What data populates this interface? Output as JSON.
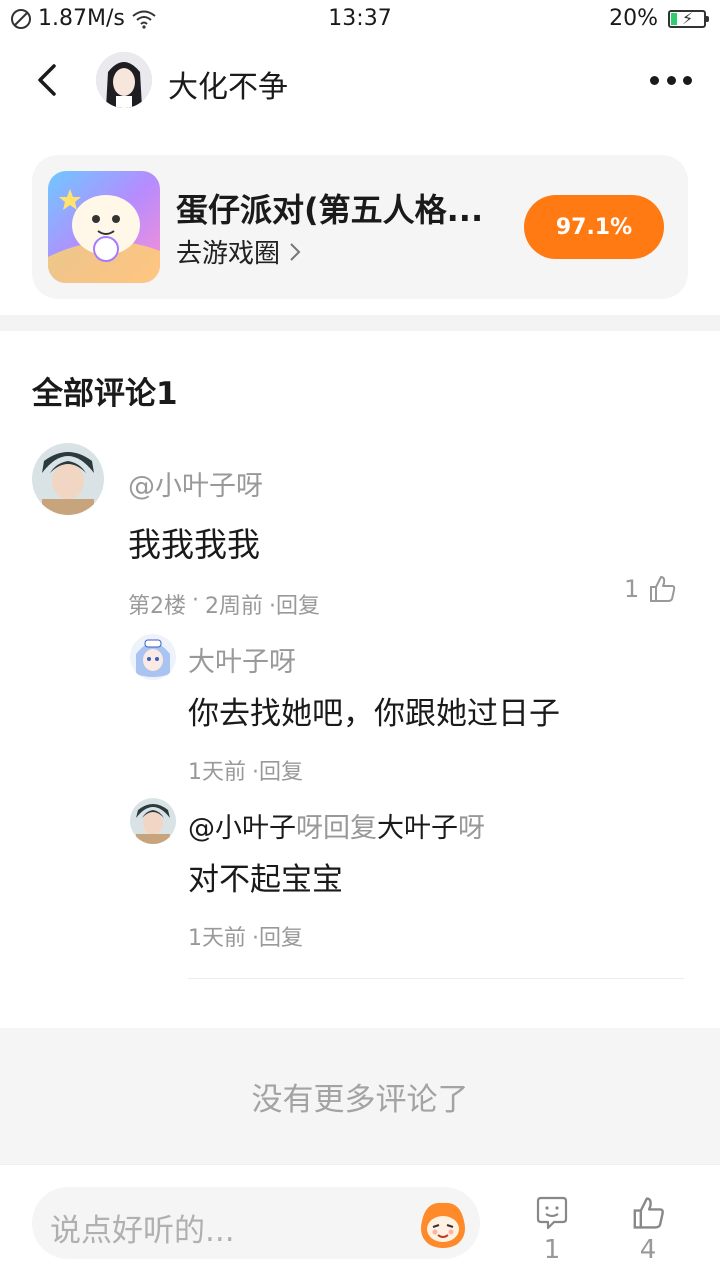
{
  "status_bar": {
    "speed": "1.87M/s",
    "time": "13:37",
    "battery": "20%",
    "battery_level": 0.2
  },
  "header": {
    "author_name": "大化不争"
  },
  "game_card": {
    "title": "蛋仔派对(第五人格...",
    "link_label": "去游戏圈",
    "rating": "97.1%"
  },
  "comments_section": {
    "title": "全部评论1",
    "comment": {
      "user": "@小叶子呀",
      "text": "我我我我",
      "floor": "第2楼",
      "time": "2周前",
      "reply_label": "·回复",
      "like_count": "1"
    },
    "replies": [
      {
        "user": "大叶子呀",
        "text": "你去找她吧，你跟她过日子",
        "time": "1天前",
        "reply_label": "·回复"
      },
      {
        "user_prefix": "@小叶子",
        "user_suffix": "呀",
        "reply_word": "回复",
        "target": "大叶子",
        "target_suffix": "呀",
        "text": "对不起宝宝",
        "time": "1天前",
        "reply_label": "·回复"
      }
    ]
  },
  "footer": {
    "no_more": "没有更多评论了"
  },
  "bottom_bar": {
    "input_placeholder": "说点好听的...",
    "comment_count": "1",
    "like_count": "4"
  },
  "colors": {
    "accent": "#ff7a12",
    "muted_text": "#999999",
    "panel_bg": "#f5f5f5"
  },
  "icons": [
    "mute-icon",
    "wifi-icon",
    "battery-icon",
    "back-icon",
    "more-icon",
    "chevron-right-icon",
    "thumb-up-icon",
    "comment-icon",
    "mascot-icon"
  ]
}
